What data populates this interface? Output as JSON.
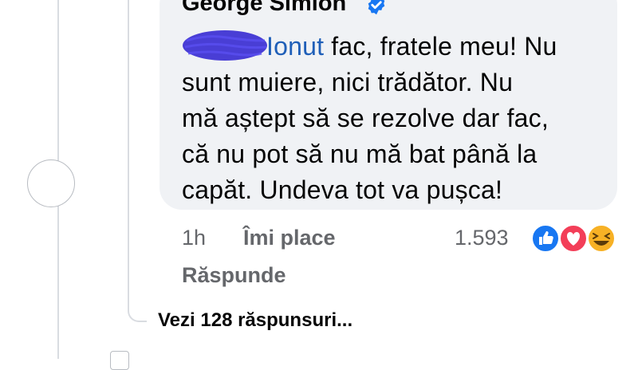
{
  "comment": {
    "author": "George Simion",
    "verified": true,
    "mention": "Ionut",
    "text_lines": [
      " fac, fratele meu! Nu",
      "sunt muiere, nici trădător. Nu",
      "mă aștept să se rezolve dar fac,",
      "că nu pot să nu mă bat până la",
      "capăt. Undeva tot va pușca!"
    ],
    "time": "1h",
    "like_label": "Îmi place",
    "reaction_count": "1.593",
    "reactions": [
      "like-icon",
      "love-icon",
      "haha-icon"
    ],
    "reply_label": "Răspunde"
  },
  "thread": {
    "view_replies_label": "Vezi 128 răspunsuri..."
  },
  "colors": {
    "bubble": "#f0f2f5",
    "mention": "#1f5fb8",
    "scribble": "#3b2fd1",
    "meta": "#65676b",
    "like": "#1877f2",
    "love": "#f33e58",
    "haha": "#f7b125"
  }
}
